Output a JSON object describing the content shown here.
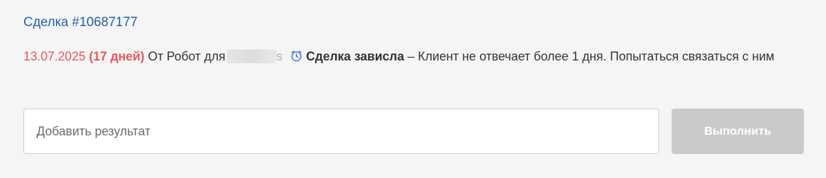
{
  "task": {
    "deal_link": "Сделка #10687177",
    "date": "13.07.2025",
    "overdue": "(17 дней)",
    "from_text": "От Робот для",
    "redacted_tail": "s",
    "task_type": "Сделка зависла",
    "description": "– Клиент не отвечает более 1 дня. Попытаться связаться с ним",
    "icon": "alarm-clock-icon",
    "accent_color": "#1f5fa6",
    "overdue_color": "#e8585f"
  },
  "result": {
    "placeholder": "Добавить результат",
    "value": ""
  },
  "actions": {
    "execute_label": "Выполнить"
  }
}
